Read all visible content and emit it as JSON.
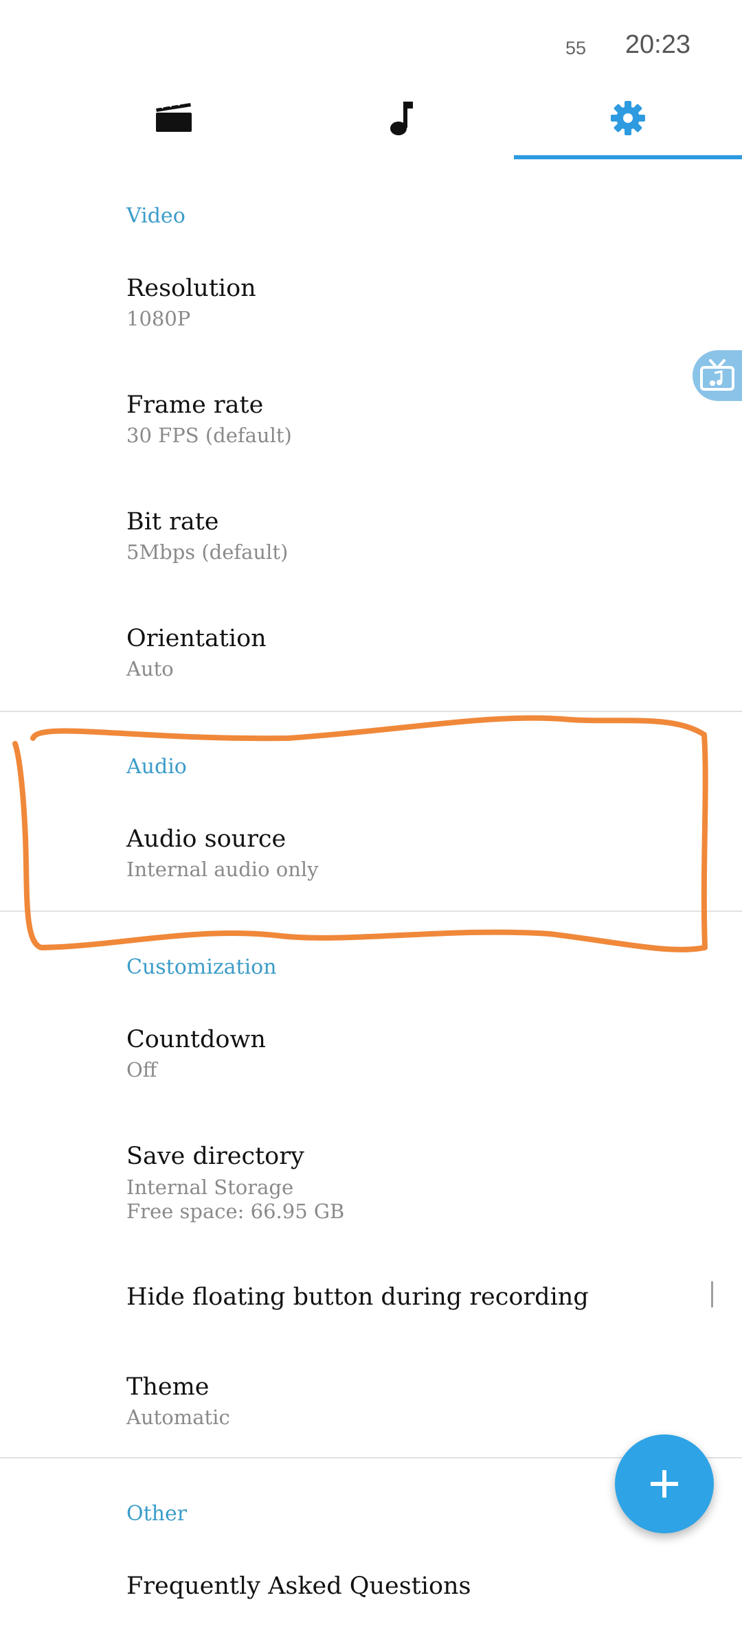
{
  "status_bar": {
    "battery": "55",
    "time": "20:23"
  },
  "tabs": [
    {
      "icon": "video-icon",
      "active": false
    },
    {
      "icon": "music-note-icon",
      "active": false
    },
    {
      "icon": "gear-icon",
      "active": true
    }
  ],
  "colors": {
    "accent": "#2e9be0",
    "section_header": "#3b9cc9",
    "annotation": "#f0883a",
    "fab": "#2ea3e5"
  },
  "sections": {
    "video": {
      "header": "Video",
      "resolution": {
        "title": "Resolution",
        "value": "1080P"
      },
      "frame_rate": {
        "title": "Frame rate",
        "value": "30 FPS (default)"
      },
      "bit_rate": {
        "title": "Bit rate",
        "value": "5Mbps (default)"
      },
      "orientation": {
        "title": "Orientation",
        "value": "Auto"
      }
    },
    "audio": {
      "header": "Audio",
      "audio_source": {
        "title": "Audio source",
        "value": "Internal audio only"
      }
    },
    "customization": {
      "header": "Customization",
      "countdown": {
        "title": "Countdown",
        "value": "Off"
      },
      "save_directory": {
        "title": "Save directory",
        "value_line1": "Internal Storage",
        "value_line2": "Free space: 66.95 GB"
      },
      "hide_floating": {
        "title": "Hide floating button during recording"
      },
      "theme": {
        "title": "Theme",
        "value": "Automatic"
      }
    },
    "other": {
      "header": "Other",
      "faq": {
        "title": "Frequently Asked Questions"
      }
    }
  },
  "floating_widget_icon": "tv-music-icon",
  "fab_icon": "plus-icon"
}
